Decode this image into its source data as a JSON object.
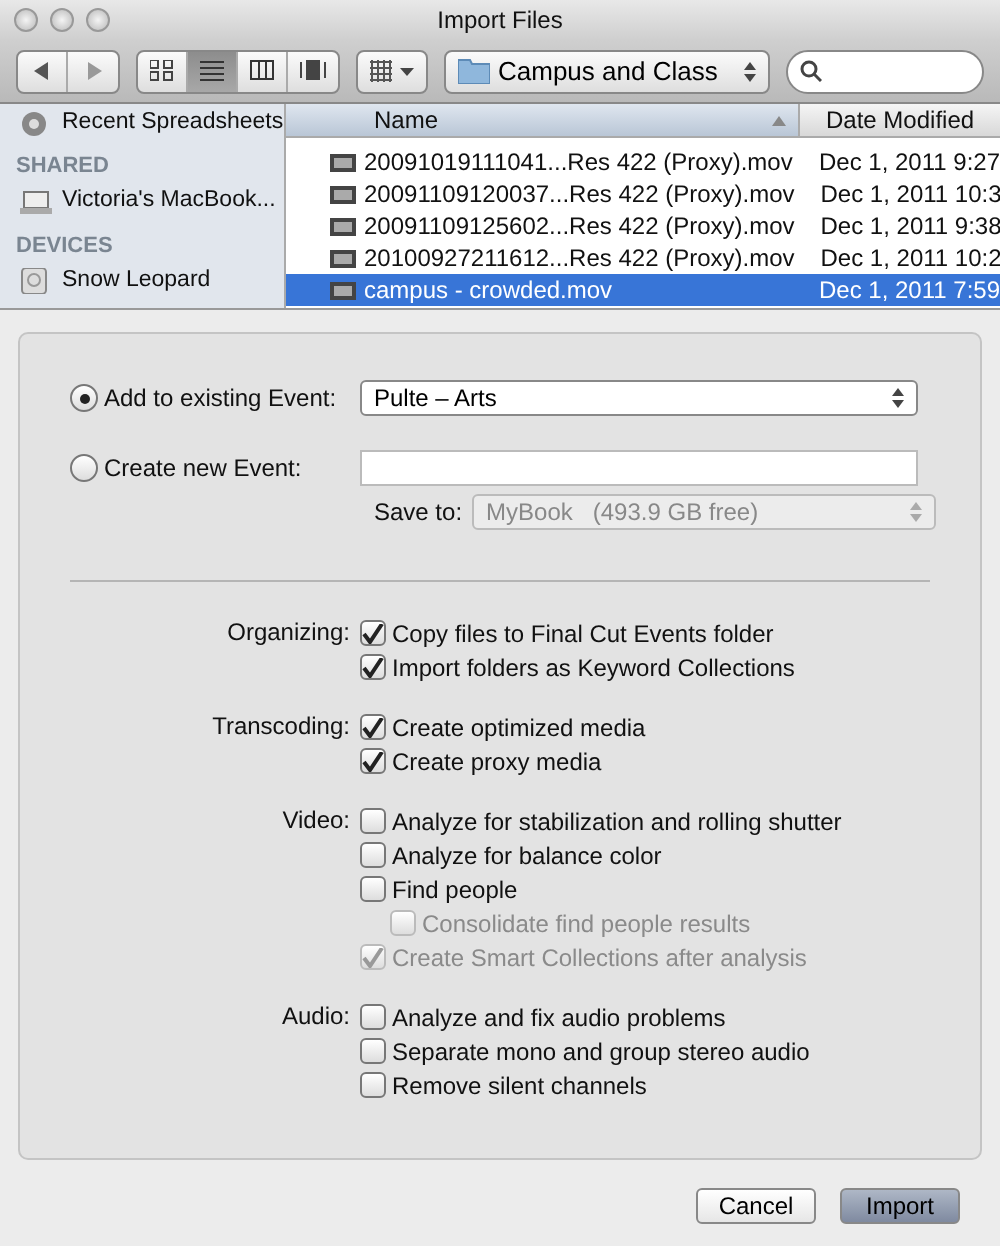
{
  "window": {
    "title": "Import Files"
  },
  "toolbar": {
    "views": [
      {
        "kind": "icons",
        "selected": false
      },
      {
        "kind": "list",
        "selected": true
      },
      {
        "kind": "columns",
        "selected": false
      },
      {
        "kind": "coverflow",
        "selected": false
      }
    ],
    "location": "Campus and Class"
  },
  "sidebar": {
    "sections": [
      {
        "items": [
          {
            "label": "Recent Spreadsheets",
            "kind": "gear"
          }
        ]
      },
      {
        "heading": "SHARED",
        "items": [
          {
            "label": "Victoria's MacBook...",
            "kind": "laptop"
          }
        ]
      },
      {
        "heading": "DEVICES",
        "items": [
          {
            "label": "Snow Leopard",
            "kind": "drive"
          }
        ]
      }
    ]
  },
  "files": {
    "columns": [
      "Name",
      "Date Modified"
    ],
    "rows": [
      {
        "name": "20091019111041...Res 422 (Proxy).mov",
        "date": "Dec 1, 2011 9:27",
        "selected": false
      },
      {
        "name": "20091109120037...Res 422 (Proxy).mov",
        "date": "Dec 1, 2011 10:3",
        "selected": false
      },
      {
        "name": "20091109125602...Res 422 (Proxy).mov",
        "date": "Dec 1, 2011 9:38",
        "selected": false
      },
      {
        "name": "20100927211612...Res 422 (Proxy).mov",
        "date": "Dec 1, 2011 10:2",
        "selected": false
      },
      {
        "name": "campus - crowded.mov",
        "date": "Dec 1, 2011 7:59",
        "selected": true
      }
    ]
  },
  "event": {
    "options": [
      {
        "label": "Add to existing Event:",
        "selected": true,
        "kind": "popup",
        "value": "Pulte – Arts"
      },
      {
        "label": "Create new Event:",
        "selected": false,
        "kind": "field"
      }
    ],
    "save_to": {
      "label": "Save to:",
      "value": "MyBook   (493.9 GB free)",
      "disabled": true
    }
  },
  "groups": [
    {
      "label": "Organizing:",
      "options": [
        {
          "label": "Copy files to Final Cut Events folder",
          "checked": true,
          "disabled": false
        },
        {
          "label": "Import folders as Keyword Collections",
          "checked": true,
          "disabled": false
        }
      ]
    },
    {
      "label": "Transcoding:",
      "options": [
        {
          "label": "Create optimized media",
          "checked": true,
          "disabled": false
        },
        {
          "label": "Create proxy media",
          "checked": true,
          "disabled": false
        }
      ]
    },
    {
      "label": "Video:",
      "options": [
        {
          "label": "Analyze for stabilization and rolling shutter",
          "checked": false,
          "disabled": false
        },
        {
          "label": "Analyze for balance color",
          "checked": false,
          "disabled": false
        },
        {
          "label": "Find people",
          "checked": false,
          "disabled": false,
          "children": [
            {
              "label": "Consolidate find people results",
              "checked": false,
              "disabled": true
            }
          ]
        },
        {
          "label": "Create Smart Collections after analysis",
          "checked": true,
          "disabled": true
        }
      ]
    },
    {
      "label": "Audio:",
      "options": [
        {
          "label": "Analyze and fix audio problems",
          "checked": false,
          "disabled": false
        },
        {
          "label": "Separate mono and group stereo audio",
          "checked": false,
          "disabled": false
        },
        {
          "label": "Remove silent channels",
          "checked": false,
          "disabled": false
        }
      ]
    }
  ],
  "buttons": [
    {
      "label": "Cancel",
      "default": false
    },
    {
      "label": "Import",
      "default": true
    }
  ]
}
